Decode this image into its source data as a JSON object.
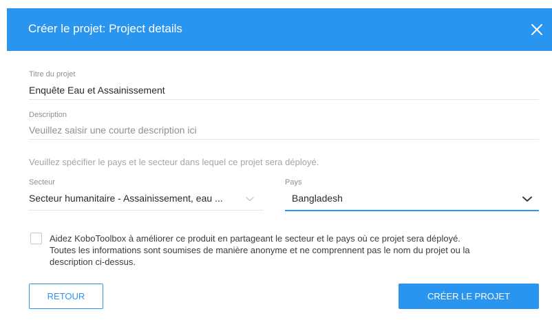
{
  "header": {
    "title": "Créer le projet: Project details",
    "close_icon": "close-icon",
    "color": "#2a95ee"
  },
  "form": {
    "title_field": {
      "label": "Titre du projet",
      "value": "Enquête Eau et Assainissement"
    },
    "description_field": {
      "label": "Description",
      "placeholder": "Veuillez saisir une courte description ici"
    },
    "instruction": "Veuillez spécifier le pays et le secteur dans lequel ce projet sera déployé.",
    "sector_field": {
      "label": "Secteur",
      "value": "Secteur humanitaire - Assainissement, eau ..."
    },
    "country_field": {
      "label": "Pays",
      "value": "Bangladesh"
    },
    "consent": {
      "checked": false,
      "line1": "Aidez KoboToolbox à améliorer ce produit en partageant le secteur et le pays où ce projet sera déployé.",
      "line2": "Toutes les informations sont soumises de manière anonyme et ne comprennent pas le nom du projet ou la",
      "line3": "description ci-dessus."
    }
  },
  "actions": {
    "back_label": "RETOUR",
    "create_label": "CRÉER LE PROJET"
  },
  "colors": {
    "accent": "#2a95ee",
    "label": "#8d8f96",
    "divider": "#e5e6ea"
  }
}
